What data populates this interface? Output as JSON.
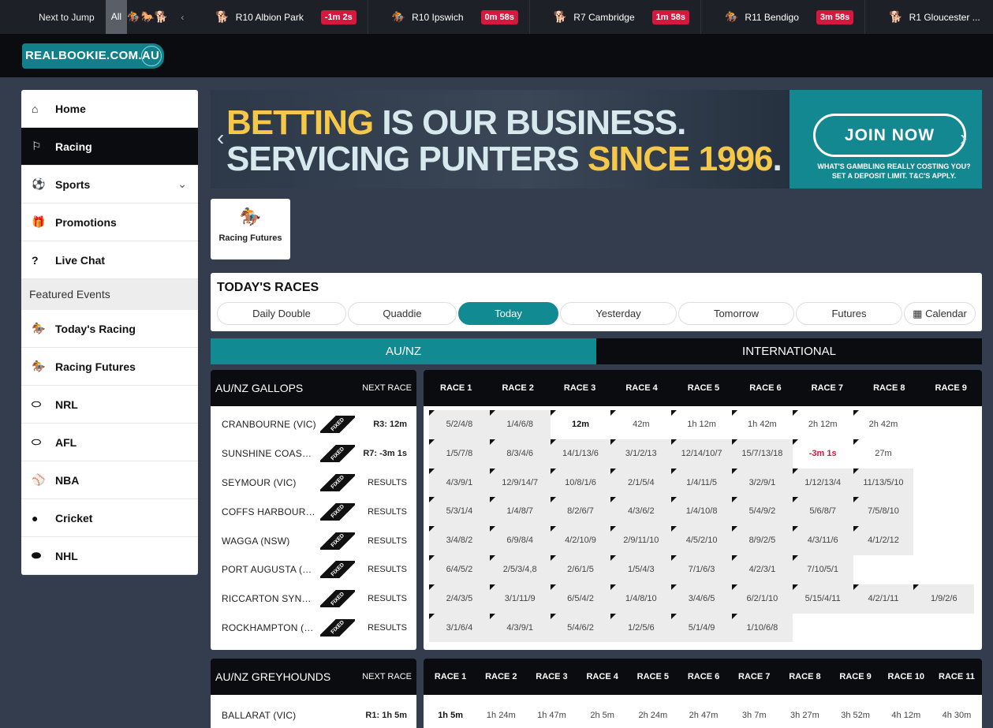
{
  "ntj": {
    "label": "Next to Jump",
    "all": "All",
    "filters": [
      "horse-icon",
      "harness-icon",
      "greyhound-icon"
    ],
    "races": [
      {
        "icon": "greyhound-icon",
        "name": "R10  Albion Park",
        "time": "-1m 2s"
      },
      {
        "icon": "horse-icon",
        "name": "R10  Ipswich",
        "time": "0m 58s"
      },
      {
        "icon": "greyhound-icon",
        "name": "R7  Cambridge",
        "time": "1m 58s"
      },
      {
        "icon": "horse-icon",
        "name": "R11  Bendigo",
        "time": "3m 58s"
      },
      {
        "icon": "greyhound-icon",
        "name": "R1  Gloucester ...",
        "time": ""
      }
    ]
  },
  "logo": {
    "text": "REALBOOKIE.COM.AU"
  },
  "sidebar": {
    "items": [
      {
        "label": "Home",
        "icon": "home-icon",
        "glyph": "⌂"
      },
      {
        "label": "Racing",
        "icon": "racing-icon",
        "glyph": "⚐"
      },
      {
        "label": "Sports",
        "icon": "soccer-ball-icon",
        "glyph": "⚽"
      },
      {
        "label": "Promotions",
        "icon": "gift-icon",
        "glyph": "🎁"
      },
      {
        "label": "Live Chat",
        "icon": "help-icon",
        "glyph": "?"
      }
    ],
    "featured_label": "Featured Events",
    "featured": [
      {
        "label": "Today's Racing",
        "icon": "horse-icon",
        "glyph": "🏇"
      },
      {
        "label": "Racing Futures",
        "icon": "horse-icon",
        "glyph": "🏇"
      },
      {
        "label": "NRL",
        "icon": "rugby-ball-icon",
        "glyph": "⬭"
      },
      {
        "label": "AFL",
        "icon": "football-icon",
        "glyph": "⬭"
      },
      {
        "label": "NBA",
        "icon": "basketball-icon",
        "glyph": "⚾"
      },
      {
        "label": "Cricket",
        "icon": "cricket-ball-icon",
        "glyph": "●"
      },
      {
        "label": "NHL",
        "icon": "hockey-puck-icon",
        "glyph": "⬬"
      }
    ]
  },
  "banner": {
    "line1_a": "BETTING",
    "line1_b": "IS OUR BUSINESS.",
    "line2_a": "SERVICING PUNTERS",
    "line2_b": "SINCE 1996",
    "line2_c": ".",
    "join": "JOIN NOW",
    "small1": "WHAT'S GAMBLING REALLY COSTING YOU?",
    "small2": "SET A DEPOSIT LIMIT. T&C'S APPLY."
  },
  "futures_tile": {
    "label": "Racing Futures"
  },
  "todays_races": {
    "title": "TODAY'S RACES",
    "tabs": [
      "Daily Double",
      "Quaddie",
      "Today",
      "Yesterday",
      "Tomorrow",
      "Futures",
      "Calendar"
    ],
    "active_tab": "Today",
    "calendar_icon": "calendar-icon"
  },
  "region": {
    "left": "AU/NZ",
    "right": "INTERNATIONAL"
  },
  "gallops": {
    "title": "AU/NZ GALLOPS",
    "next_race_label": "NEXT RACE",
    "fixed_label": "FIXED",
    "race_headers": [
      "RACE 1",
      "RACE 2",
      "RACE 3",
      "RACE 4",
      "RACE 5",
      "RACE 6",
      "RACE 7",
      "RACE 8",
      "RACE 9"
    ],
    "meetings": [
      {
        "name": "CRANBOURNE (VIC)",
        "next": "R3: 12m",
        "bold": true,
        "cells": [
          "5/2/4/8",
          "1/4/6/8",
          "12m",
          "42m",
          "1h 12m",
          "1h 42m",
          "2h 12m",
          "2h 42m",
          ""
        ]
      },
      {
        "name": "SUNSHINE COAST (Q...",
        "next": "R7: -3m 1s",
        "bold": true,
        "cells": [
          "1/5/7/8",
          "8/3/4/6",
          "14/1/13/6",
          "3/1/2/13",
          "12/14/10/7",
          "15/7/13/18",
          "-3m 1s",
          "27m",
          ""
        ]
      },
      {
        "name": "SEYMOUR (VIC)",
        "next": "RESULTS",
        "bold": false,
        "cells": [
          "4/3/9/1",
          "12/9/14/7",
          "10/8/1/6",
          "2/1/5/4",
          "1/4/11/5",
          "3/2/9/1",
          "1/12/13/4",
          "11/13/5/10",
          ""
        ]
      },
      {
        "name": "COFFS HARBOUR (N...",
        "next": "RESULTS",
        "bold": false,
        "cells": [
          "5/3/1/4",
          "1/4/8/7",
          "8/2/6/7",
          "4/3/6/2",
          "1/4/10/8",
          "5/4/9/2",
          "5/6/8/7",
          "7/5/8/10",
          ""
        ]
      },
      {
        "name": "WAGGA (NSW)",
        "next": "RESULTS",
        "bold": false,
        "cells": [
          "3/4/8/2",
          "6/9/8/4",
          "4/2/10/9",
          "2/9/11/10",
          "4/5/2/10",
          "8/9/2/5",
          "4/3/11/6",
          "4/1/2/12",
          ""
        ]
      },
      {
        "name": "PORT AUGUSTA (SA)",
        "next": "RESULTS",
        "bold": false,
        "cells": [
          "6/4/5/2",
          "2/5/3/4,8",
          "2/6/1/5",
          "1/5/4/3",
          "7/1/6/3",
          "4/2/3/1",
          "7/10/5/1",
          "",
          ""
        ]
      },
      {
        "name": "RICCARTON SYNTHE...",
        "next": "RESULTS",
        "bold": false,
        "cells": [
          "2/4/3/5",
          "3/1/11/9",
          "6/5/4/2",
          "1/4/8/10",
          "3/4/6/5",
          "6/2/1/10",
          "5/15/4/11",
          "4/2/1/11",
          "1/9/2/6"
        ]
      },
      {
        "name": "ROCKHAMPTON (QLD)",
        "next": "RESULTS",
        "bold": false,
        "cells": [
          "3/1/6/4",
          "4/3/9/1",
          "5/4/6/2",
          "1/2/5/6",
          "5/1/4/9",
          "1/10/6/8",
          "",
          "",
          ""
        ]
      }
    ]
  },
  "greyhounds": {
    "title": "AU/NZ GREYHOUNDS",
    "next_race_label": "NEXT RACE",
    "race_headers": [
      "RACE 1",
      "RACE 2",
      "RACE 3",
      "RACE 4",
      "RACE 5",
      "RACE 6",
      "RACE 7",
      "RACE 8",
      "RACE 9",
      "RACE 10",
      "RACE 11"
    ],
    "meetings": [
      {
        "name": "BALLARAT (VIC)",
        "next": "R1: 1h 5m",
        "cells": [
          "1h 5m",
          "1h 24m",
          "1h 47m",
          "2h 5m",
          "2h 24m",
          "2h 47m",
          "3h 7m",
          "3h 27m",
          "3h 52m",
          "4h 12m",
          "4h 30m"
        ]
      }
    ]
  }
}
